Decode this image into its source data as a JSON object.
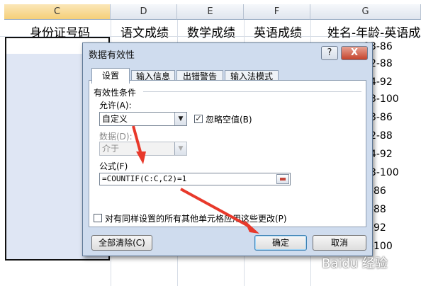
{
  "spreadsheet": {
    "columns": [
      "C",
      "D",
      "E",
      "F",
      "G"
    ],
    "headers": [
      "身份证号码",
      "语文成绩",
      "数学成绩",
      "英语成绩",
      "姓名-年龄-英语成绩"
    ],
    "g_values": [
      "-13-86",
      "-12-88",
      "-14-92",
      "-13-100",
      "-13-86",
      "-12-88",
      "-14-92",
      "-13-100",
      "-3-86",
      "-2-88",
      "-4-92",
      "-3-100"
    ],
    "selection_color": "#dfe6f4"
  },
  "dialog": {
    "title": "数据有效性",
    "help": "?",
    "close": "X",
    "tabs": [
      "设置",
      "输入信息",
      "出错警告",
      "输入法模式"
    ],
    "section": "有效性条件",
    "allow_label": "允许(A):",
    "allow_value": "自定义",
    "ignore_blank": "忽略空值(B)",
    "data_label": "数据(D):",
    "data_value": "介于",
    "formula_label": "公式(F)",
    "formula_value": "=COUNTIF(C:C,C2)=1",
    "apply_all": "对有同样设置的所有其他单元格应用这些更改(P)",
    "clear_all": "全部清除(C)",
    "ok": "确定",
    "cancel": "取消"
  },
  "watermark": "Baidu 经验",
  "arrow_color": "#e8392b"
}
